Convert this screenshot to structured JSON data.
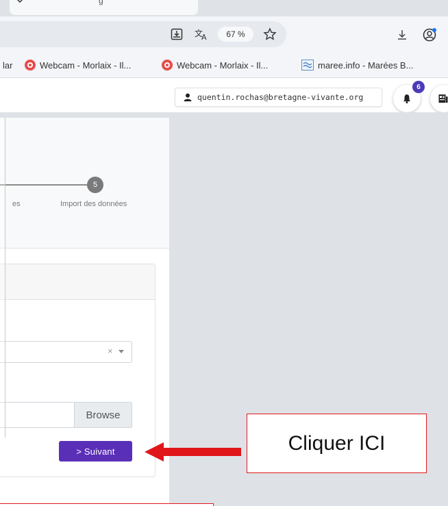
{
  "browser": {
    "tab_fragment_text": "g",
    "zoom_level": "67 %",
    "bookmarks": [
      {
        "label": "lar"
      },
      {
        "label": "Webcam - Morlaix - Il..."
      },
      {
        "label": "Webcam - Morlaix - Il..."
      },
      {
        "label": "maree.info - Marées B..."
      }
    ]
  },
  "header": {
    "user_email": "quentin.rochas@bretagne-vivante.org",
    "notification_count": "6"
  },
  "stepper": {
    "prev_label_fragment": "es",
    "step_number": "5",
    "step_label": "Import des données"
  },
  "form": {
    "select_clear": "×",
    "browse_label": "Browse",
    "next_label": "> Suivant"
  },
  "annotation": {
    "callout_text": "Cliquer ICI",
    "arrow_color": "#e0161b",
    "box_color": "#e0161b"
  },
  "colors": {
    "accent": "#5a2fb8",
    "badge": "#4b3bb8",
    "gray_bg": "#dee2e6"
  }
}
